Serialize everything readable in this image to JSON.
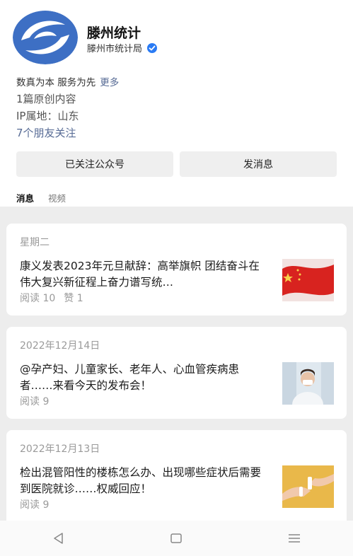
{
  "account": {
    "name": "滕州统计",
    "organization": "滕州市统计局",
    "motto": "数真为本 服务为先",
    "more_label": "更多",
    "original_count": "1篇原创内容",
    "ip_location": "IP属地：山东",
    "friends_following": "7个朋友关注"
  },
  "actions": {
    "follow_label": "已关注公众号",
    "message_label": "发消息"
  },
  "tabs": [
    {
      "label": "消息",
      "active": true
    },
    {
      "label": "视频",
      "active": false
    }
  ],
  "articles": [
    {
      "date": "星期二",
      "title": "康义发表2023年元旦献辞：高举旗帜 团结奋斗在伟大复兴新征程上奋力谱写统…",
      "reads": "阅读 10",
      "likes": "赞 1",
      "thumb_icon": "flag-thumbnail"
    },
    {
      "date": "2022年12月14日",
      "title": "@孕产妇、儿童家长、老年人、心血管疾病患者……来看今天的发布会！",
      "reads": "阅读 9",
      "thumb_icon": "masked-person-thumbnail"
    },
    {
      "date": "2022年12月13日",
      "title": "检出混管阳性的楼栋怎么办、出现哪些症状后需要到医院就诊……权威回应！",
      "reads": "阅读 9",
      "thumb_icon": "hands-thumbnail"
    }
  ],
  "nav": {
    "back_icon": "triangle-back-icon",
    "home_icon": "square-home-icon",
    "menu_icon": "hamburger-menu-icon"
  },
  "colors": {
    "link": "#576b95",
    "verified": "#2a7bf4",
    "feed_background": "#ededed"
  }
}
